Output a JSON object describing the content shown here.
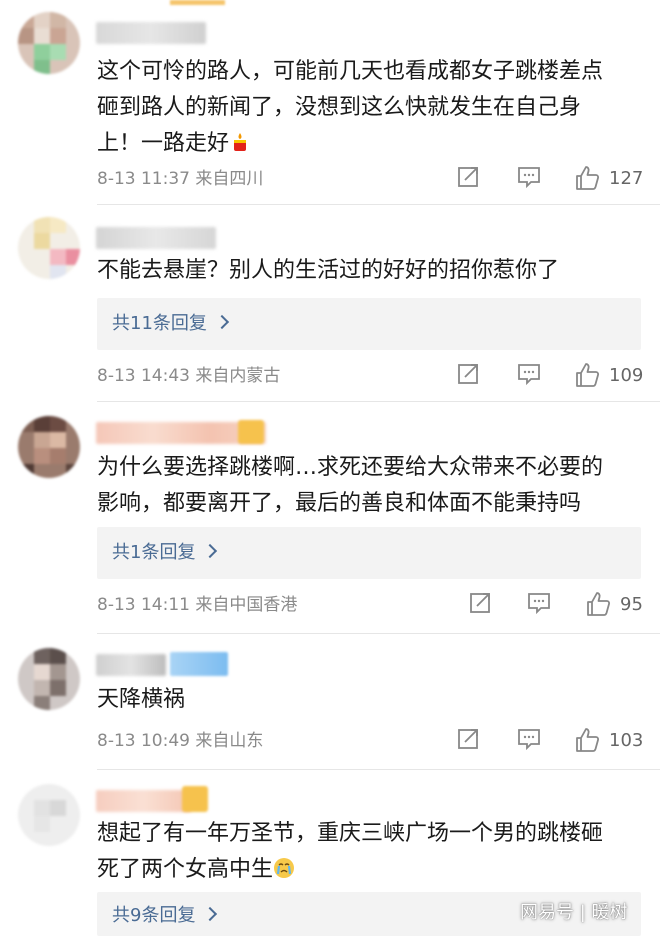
{
  "comments": [
    {
      "text_lines": [
        "这个可怜的路人，可能前几天也看成都女子跳楼差点",
        "砸到路人的新闻了，没想到这么快就发生在自己身",
        "上！一路走好"
      ],
      "emoji": "candle-icon",
      "date_loc": "8-13 11:37  来自四川",
      "likes": "127",
      "replies": ""
    },
    {
      "text_lines": [
        "不能去悬崖？别人的生活过的好好的招你惹你了"
      ],
      "date_loc": "8-13 14:43  来自内蒙古",
      "likes": "109",
      "replies": "共11条回复"
    },
    {
      "text_lines": [
        "为什么要选择跳楼啊…求死还要给大众带来不必要的",
        "影响，都要离开了，最后的善良和体面不能秉持吗"
      ],
      "date_loc": "8-13 14:11  来自中国香港",
      "likes": "95",
      "replies": "共1条回复"
    },
    {
      "text_lines": [
        "天降横祸"
      ],
      "date_loc": "8-13 10:49  来自山东",
      "likes": "103",
      "replies": ""
    },
    {
      "text_lines": [
        "想起了有一年万圣节，重庆三峡广场一个男的跳楼砸",
        "死了两个女高中生"
      ],
      "emoji": "crying-face-icon",
      "replies": "共9条回复"
    }
  ],
  "watermark": "网易号 | 暖树"
}
